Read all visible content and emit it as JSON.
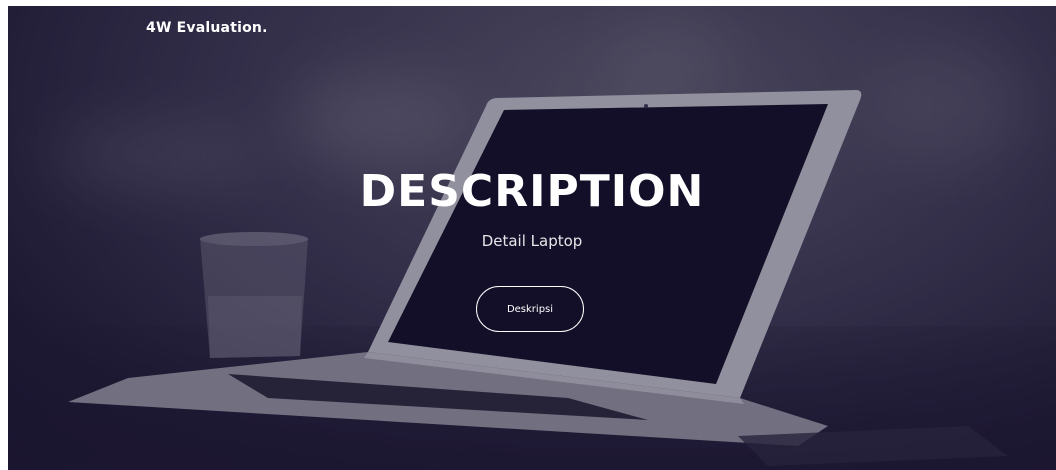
{
  "navbar": {
    "brand": "4W Evaluation."
  },
  "hero": {
    "title": "DESCRIPTION",
    "subtitle": "Detail Laptop",
    "button_label": "Deskripsi"
  },
  "colors": {
    "background_dark": "#1e1a33",
    "text": "#ffffff"
  }
}
